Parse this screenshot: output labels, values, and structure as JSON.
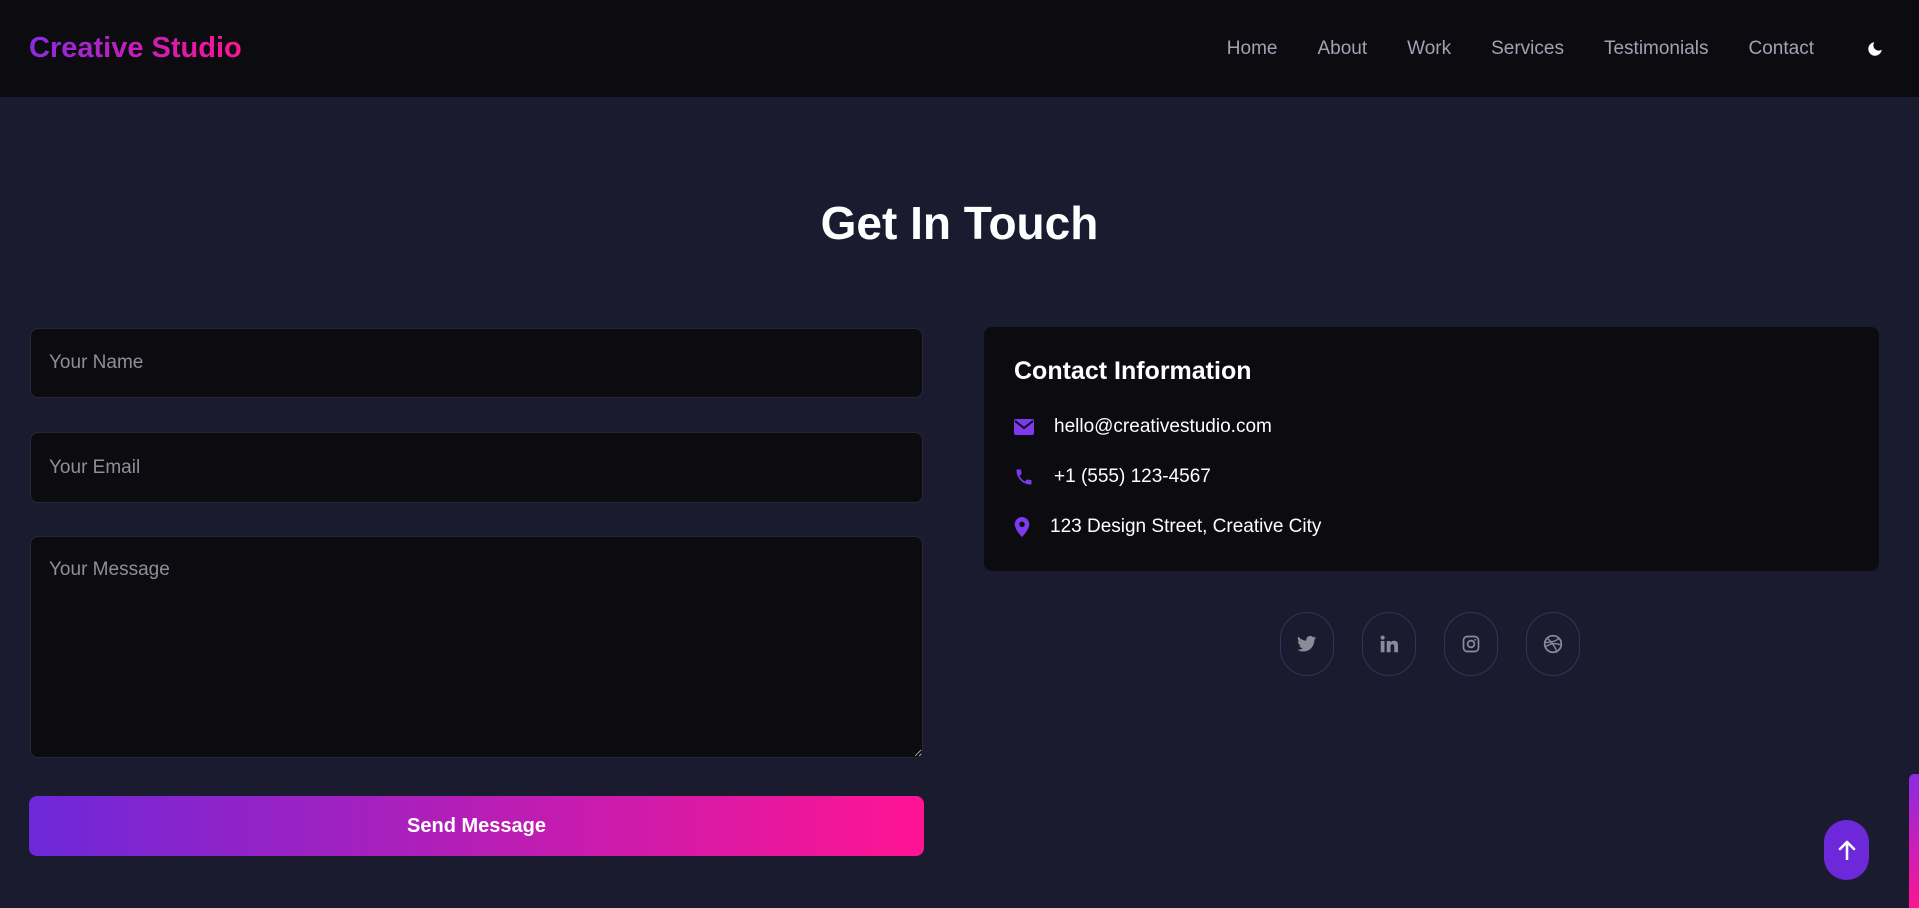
{
  "brand": "Creative Studio",
  "nav": {
    "links": [
      "Home",
      "About",
      "Work",
      "Services",
      "Testimonials",
      "Contact"
    ],
    "theme_toggle_icon": "moon-icon"
  },
  "contact_section": {
    "title": "Get In Touch",
    "form": {
      "name_placeholder": "Your Name",
      "email_placeholder": "Your Email",
      "message_placeholder": "Your Message",
      "name_value": "",
      "email_value": "",
      "message_value": "",
      "submit_label": "Send Message"
    },
    "info": {
      "title": "Contact Information",
      "email": "hello@creativestudio.com",
      "phone": "+1 (555) 123-4567",
      "address": "123 Design Street, Creative City",
      "email_icon": "envelope-icon",
      "phone_icon": "phone-icon",
      "address_icon": "map-pin-icon"
    },
    "socials": [
      "twitter-icon",
      "linkedin-icon",
      "instagram-icon",
      "dribbble-icon"
    ]
  },
  "back_to_top_icon": "arrow-up-icon",
  "colors": {
    "accent_purple": "#6d28d9",
    "accent_pink": "#ff1493",
    "background": "#1b1b2f",
    "surface": "#0b0b10",
    "nav_text": "#a0a3b1"
  }
}
